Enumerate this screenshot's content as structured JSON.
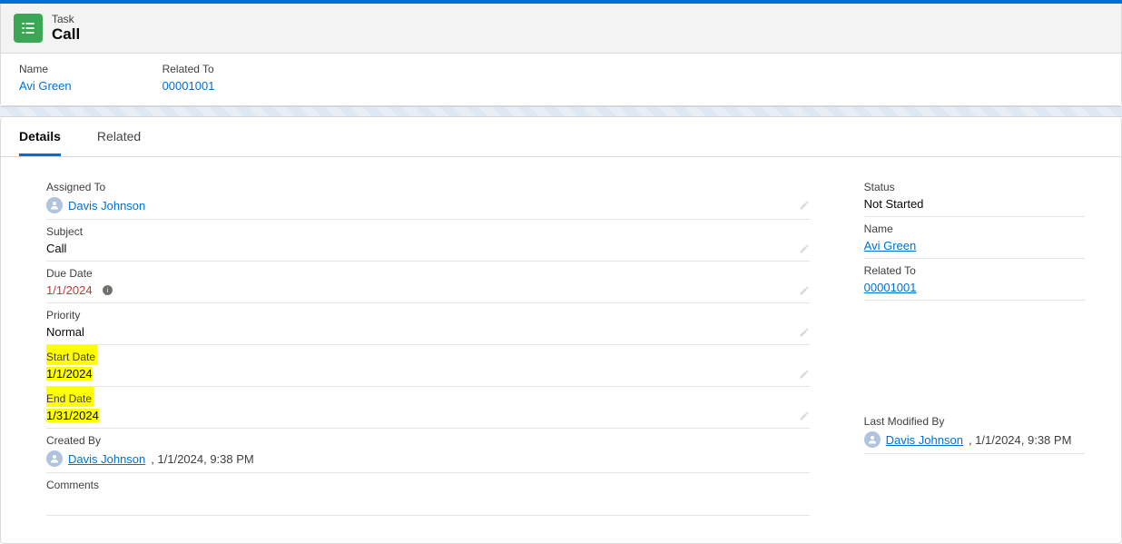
{
  "header": {
    "object_label": "Task",
    "record_title": "Call",
    "fields": {
      "name": {
        "label": "Name",
        "value": "Avi Green"
      },
      "related_to": {
        "label": "Related To",
        "value": "00001001"
      }
    }
  },
  "tabs": {
    "details": "Details",
    "related": "Related"
  },
  "details": {
    "assigned_to": {
      "label": "Assigned To",
      "value": "Davis Johnson"
    },
    "subject": {
      "label": "Subject",
      "value": "Call"
    },
    "due_date": {
      "label": "Due Date",
      "value": "1/1/2024"
    },
    "priority": {
      "label": "Priority",
      "value": "Normal"
    },
    "start_date": {
      "label": "Start Date",
      "value": "1/1/2024"
    },
    "end_date": {
      "label": "End Date",
      "value": "1/31/2024"
    },
    "created_by": {
      "label": "Created By",
      "user": "Davis Johnson",
      "time": ", 1/1/2024, 9:38 PM"
    },
    "comments": {
      "label": "Comments",
      "value": ""
    }
  },
  "side": {
    "status": {
      "label": "Status",
      "value": "Not Started"
    },
    "name": {
      "label": "Name",
      "value": "Avi Green"
    },
    "related_to": {
      "label": "Related To",
      "value": "00001001"
    },
    "last_modified_by": {
      "label": "Last Modified By",
      "user": "Davis Johnson",
      "time": ", 1/1/2024, 9:38 PM"
    }
  }
}
